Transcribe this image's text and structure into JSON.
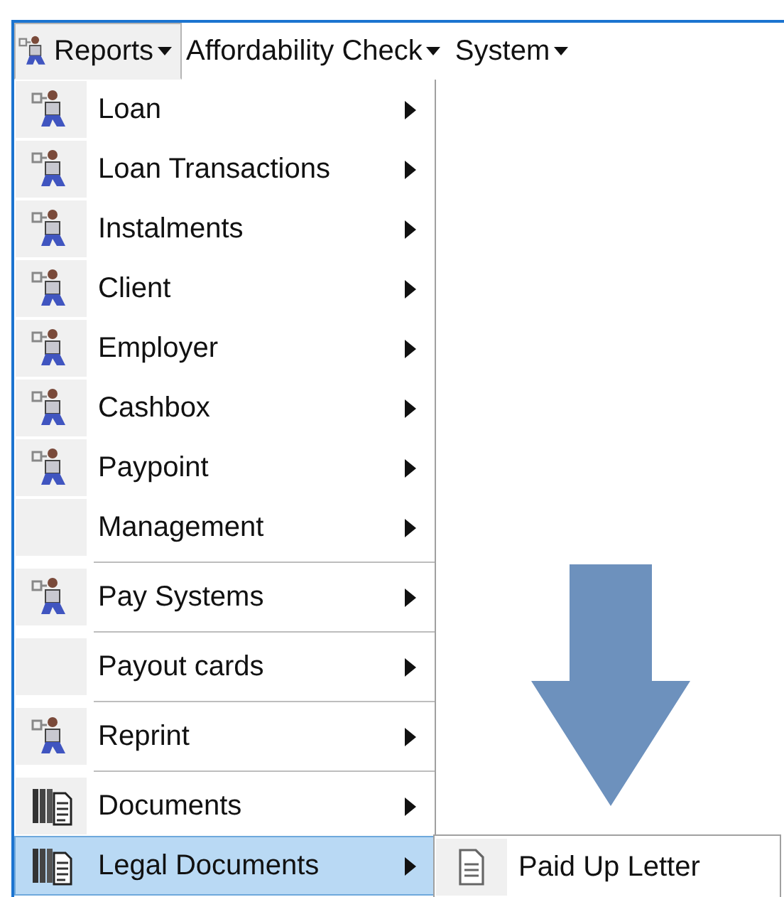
{
  "menubar": [
    {
      "label": "Reports",
      "kind": "person",
      "has_dropdown": true,
      "selected": true
    },
    {
      "label": "Affordability Check",
      "kind": "plain",
      "has_dropdown": true,
      "selected": false
    },
    {
      "label": "System",
      "kind": "plain",
      "has_dropdown": true,
      "selected": false
    }
  ],
  "menu": [
    {
      "label": "Loan",
      "kind": "person",
      "has_submenu": true,
      "separator_before": false,
      "selected": false
    },
    {
      "label": "Loan Transactions",
      "kind": "person",
      "has_submenu": true,
      "separator_before": false,
      "selected": false
    },
    {
      "label": "Instalments",
      "kind": "person",
      "has_submenu": true,
      "separator_before": false,
      "selected": false
    },
    {
      "label": "Client",
      "kind": "person",
      "has_submenu": true,
      "separator_before": false,
      "selected": false
    },
    {
      "label": "Employer",
      "kind": "person",
      "has_submenu": true,
      "separator_before": false,
      "selected": false
    },
    {
      "label": "Cashbox",
      "kind": "person",
      "has_submenu": true,
      "separator_before": false,
      "selected": false
    },
    {
      "label": "Paypoint",
      "kind": "person",
      "has_submenu": true,
      "separator_before": false,
      "selected": false
    },
    {
      "label": "Management",
      "kind": "plain",
      "has_submenu": true,
      "separator_before": false,
      "selected": false
    },
    {
      "label": "Pay Systems",
      "kind": "person",
      "has_submenu": true,
      "separator_before": true,
      "selected": false
    },
    {
      "label": "Payout cards",
      "kind": "plain",
      "has_submenu": true,
      "separator_before": true,
      "selected": false
    },
    {
      "label": "Reprint",
      "kind": "person",
      "has_submenu": true,
      "separator_before": true,
      "selected": false
    },
    {
      "label": "Documents",
      "kind": "documents",
      "has_submenu": true,
      "separator_before": true,
      "selected": false
    },
    {
      "label": "Legal Documents",
      "kind": "documents",
      "has_submenu": true,
      "separator_before": false,
      "selected": true
    }
  ],
  "submenu": [
    {
      "label": "Paid Up Letter",
      "kind": "page",
      "has_submenu": false,
      "separator_before": false,
      "selected": false
    }
  ]
}
